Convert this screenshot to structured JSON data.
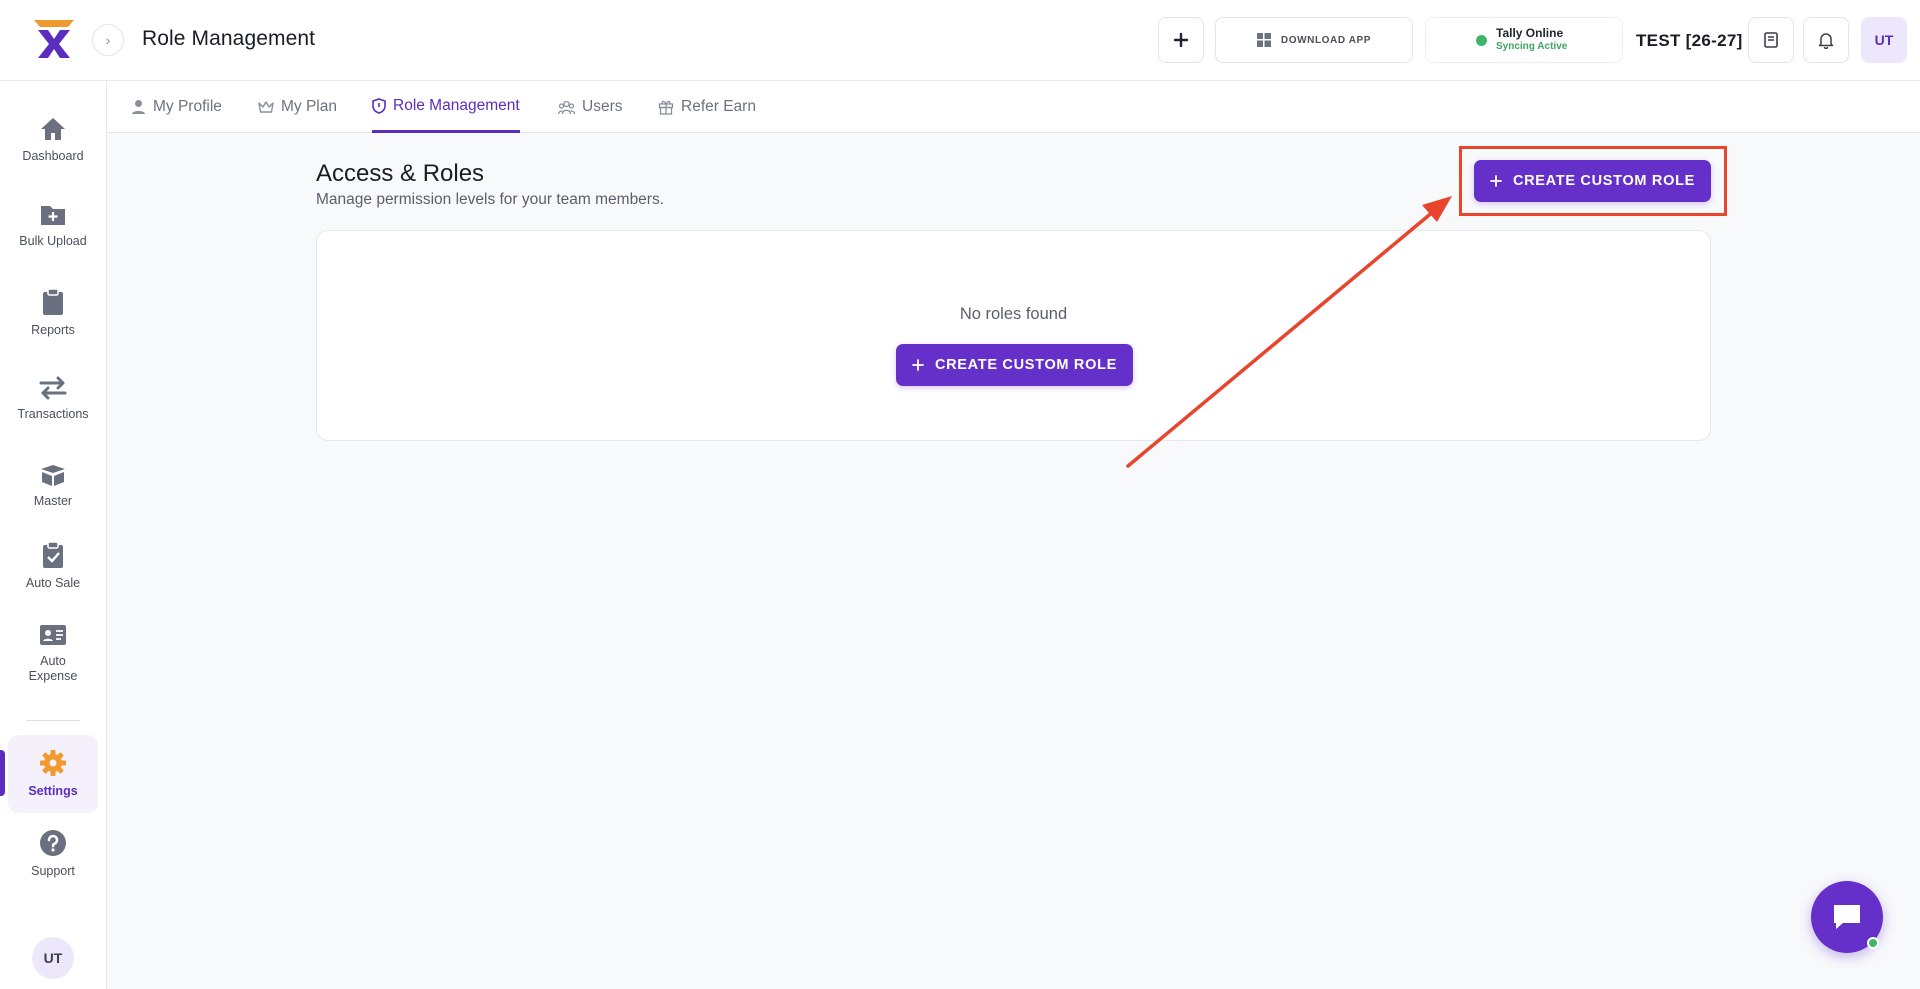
{
  "header": {
    "title": "Role Management",
    "download_label": "DOWNLOAD APP",
    "tally_title": "Tally Online",
    "tally_status": "Syncing Active",
    "company": "TEST [26-27]",
    "avatar_initials": "UT"
  },
  "sidebar": {
    "items": [
      {
        "label": "Dashboard",
        "icon": "home-icon"
      },
      {
        "label": "Bulk Upload",
        "icon": "folder-plus-icon"
      },
      {
        "label": "Reports",
        "icon": "clipboard-icon"
      },
      {
        "label": "Transactions",
        "icon": "swap-arrows-icon"
      },
      {
        "label": "Master",
        "icon": "box-icon"
      },
      {
        "label": "Auto Sale",
        "icon": "clipboard-check-icon"
      },
      {
        "label": "Auto Expense",
        "icon": "id-card-icon"
      },
      {
        "label": "Settings",
        "icon": "gear-icon",
        "active": true
      },
      {
        "label": "Support",
        "icon": "help-icon"
      }
    ],
    "avatar_initials": "UT"
  },
  "tabs": [
    {
      "label": "My Profile",
      "icon": "user-icon"
    },
    {
      "label": "My Plan",
      "icon": "crown-icon"
    },
    {
      "label": "Role Management",
      "icon": "shield-icon",
      "active": true
    },
    {
      "label": "Users",
      "icon": "users-icon"
    },
    {
      "label": "Refer Earn",
      "icon": "gift-icon"
    }
  ],
  "main": {
    "title": "Access & Roles",
    "subtitle": "Manage permission levels for your team members.",
    "create_button_label": "CREATE CUSTOM ROLE",
    "empty_text": "No roles found",
    "empty_button_label": "CREATE CUSTOM ROLE"
  },
  "colors": {
    "accent": "#6530c9",
    "highlight": "#e8452c",
    "online": "#3fb56a",
    "settings_icon": "#f2992e"
  }
}
